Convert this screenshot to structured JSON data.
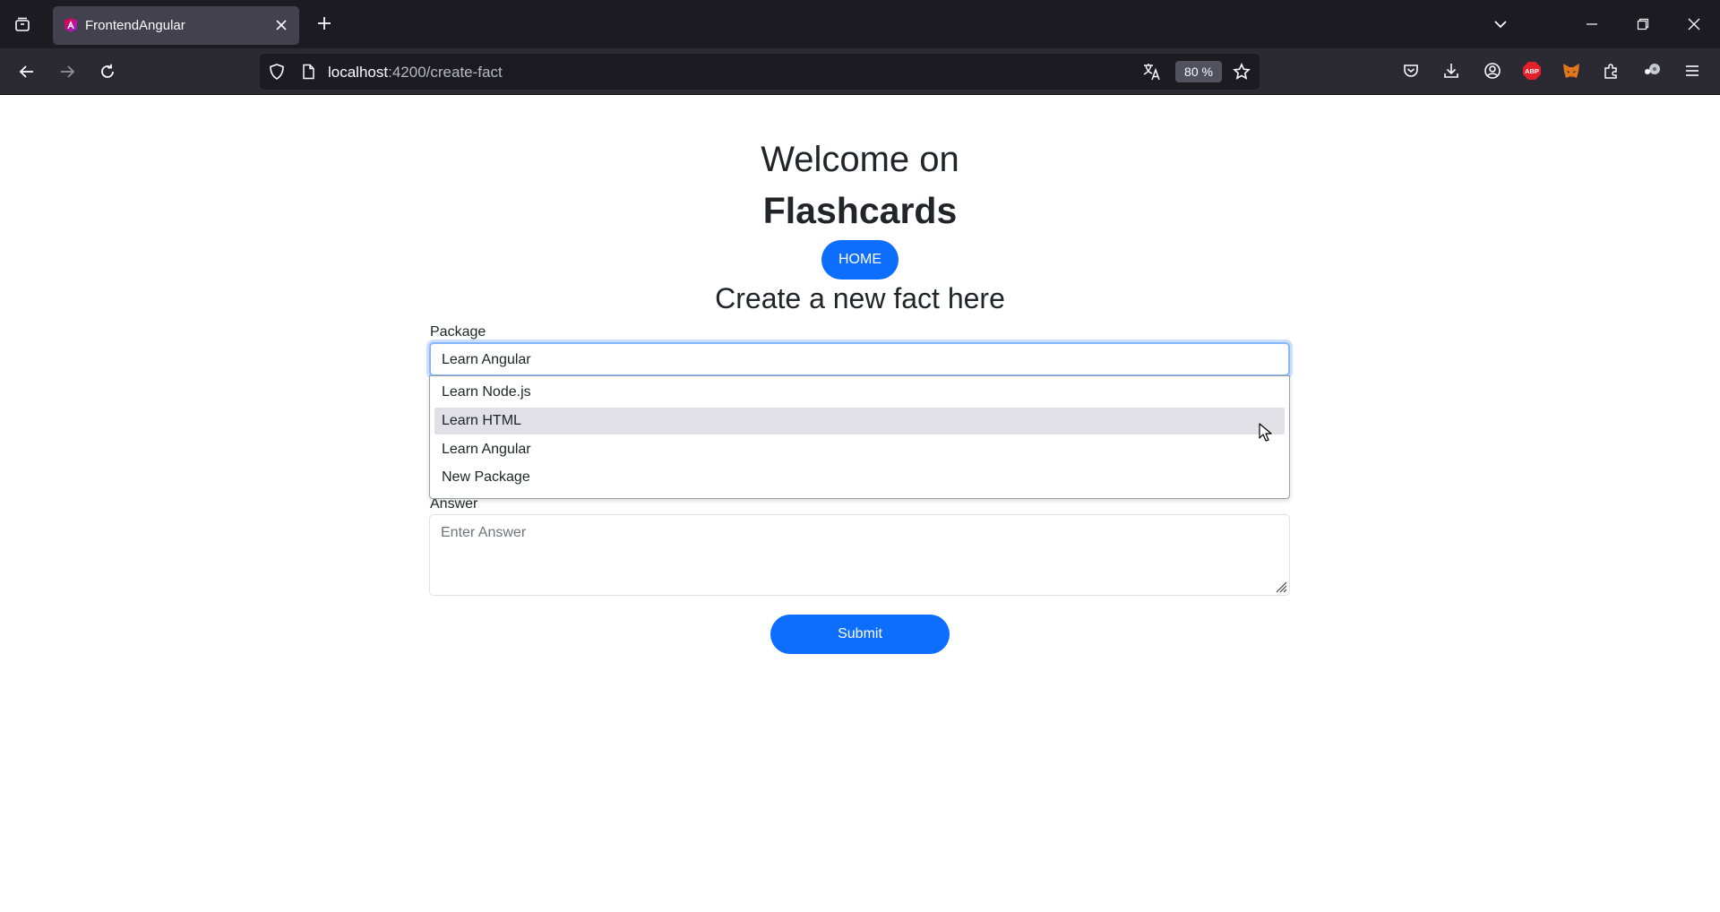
{
  "browser": {
    "tab_title": "FrontendAngular",
    "url_host": "localhost",
    "url_path": ":4200/create-fact",
    "zoom": "80 %",
    "icons": [
      "tab-list-icon",
      "close-icon",
      "plus-icon",
      "chevron-down-icon",
      "minimize-icon",
      "restore-icon",
      "window-close-icon",
      "back-icon",
      "forward-icon",
      "reload-icon",
      "shield-icon",
      "page-icon",
      "translate-icon",
      "star-icon",
      "pocket-icon",
      "download-icon",
      "account-icon",
      "adblock-icon",
      "metamask-icon",
      "extensions-icon",
      "profile-icon",
      "menu-icon"
    ],
    "adblock_label": "ABP"
  },
  "header": {
    "welcome": "Welcome on",
    "brand": "Flashcards",
    "home_label": "HOME"
  },
  "form": {
    "heading": "Create a new fact here",
    "package_label": "Package",
    "package_value": "Learn Angular",
    "package_options": [
      "Learn Node.js",
      "Learn HTML",
      "Learn Angular",
      "New Package"
    ],
    "highlighted_option": "Learn HTML",
    "answer_label": "Answer",
    "answer_placeholder": "Enter Answer",
    "submit_label": "Submit"
  },
  "colors": {
    "primary": "#0d6efd",
    "chrome_dark": "#1c1b22",
    "toolbar": "#2b2a33",
    "tab_active": "#42414d"
  }
}
